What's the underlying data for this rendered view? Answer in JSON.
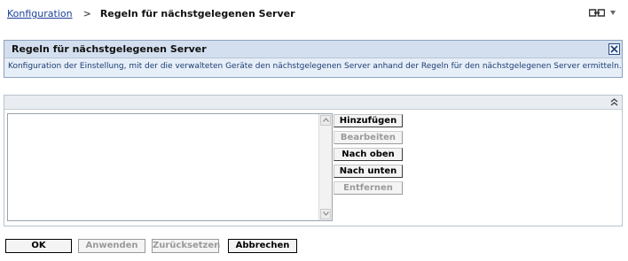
{
  "breadcrumb": {
    "link_label": "Konfiguration",
    "separator": ">",
    "current": "Regeln für nächstgelegenen Server"
  },
  "top_icons": {
    "view": "view-toggle-icon",
    "menu": "dropdown-arrow-icon"
  },
  "info_panel": {
    "title": "Regeln für nächstgelegenen Server",
    "description": "Konfiguration der Einstellung, mit der die verwalteten Geräte den nächstgelegenen Server anhand der Regeln für den nächstgelegenen Server ermitteln.",
    "close_icon": "close-icon"
  },
  "rules_panel": {
    "collapse_icon": "collapse-up-icon",
    "rules": [],
    "buttons": [
      {
        "label": "Hinzufügen",
        "enabled": true
      },
      {
        "label": "Bearbeiten",
        "enabled": false
      },
      {
        "label": "Nach oben",
        "enabled": true
      },
      {
        "label": "Nach unten",
        "enabled": true
      },
      {
        "label": "Entfernen",
        "enabled": false
      }
    ]
  },
  "footer": {
    "buttons": [
      {
        "label": "OK",
        "enabled": true
      },
      {
        "label": "Anwenden",
        "enabled": false
      },
      {
        "label": "Zurücksetzen",
        "enabled": false
      },
      {
        "label": "Abbrechen",
        "enabled": true
      }
    ]
  },
  "colors": {
    "link": "#1b3f9a",
    "panel_header": "#d3dfee",
    "panel_body": "#e6eef8",
    "description_text": "#1d3e73",
    "disabled_text": "#9a9a9a"
  }
}
